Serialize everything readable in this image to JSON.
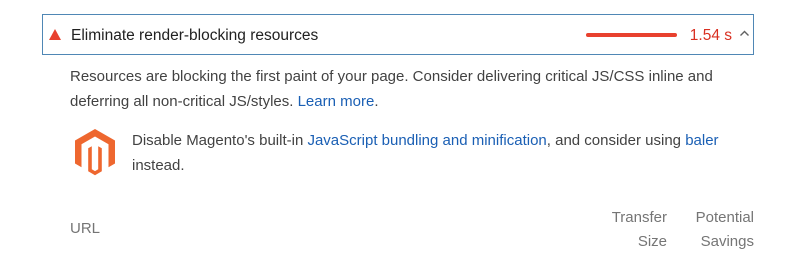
{
  "audit": {
    "title": "Eliminate render-blocking resources",
    "savings": "1.54 s",
    "status_color": "#e8412e",
    "icon": "fail-triangle-icon",
    "expanded": true
  },
  "description": {
    "text_before": "Resources are blocking the first paint of your page. Consider delivering critical JS/CSS inline and deferring all non-critical JS/styles. ",
    "link_label": "Learn more",
    "text_after": "."
  },
  "stack_pack": {
    "icon": "magento-logo-icon",
    "text_before": "Disable Magento's built-in ",
    "link1_label": "JavaScript bundling and minification",
    "text_middle": ", and consider using ",
    "link2_label": "baler",
    "text_after": " instead."
  },
  "table": {
    "columns": {
      "url": "URL",
      "transfer_line1": "Transfer",
      "transfer_line2": "Size",
      "savings_line1": "Potential",
      "savings_line2": "Savings"
    }
  },
  "colors": {
    "fail": "#e8412e",
    "fail_text": "#d93022",
    "link": "#1a5fb4",
    "focus_border": "#4f87b5",
    "magento_orange": "#ee672f"
  }
}
